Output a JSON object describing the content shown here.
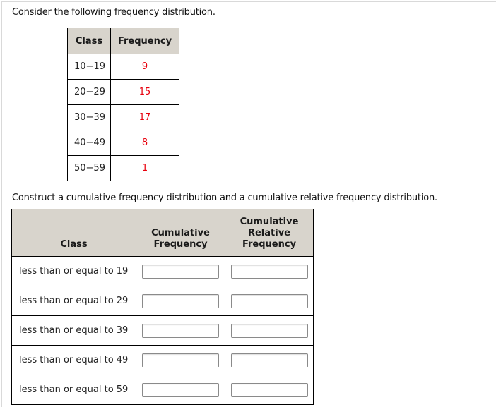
{
  "intro_text": "Consider the following frequency distribution.",
  "frequency_table": {
    "headers": [
      "Class",
      "Frequency"
    ],
    "rows": [
      {
        "class": "10−19",
        "frequency": "9"
      },
      {
        "class": "20−29",
        "frequency": "15"
      },
      {
        "class": "30−39",
        "frequency": "17"
      },
      {
        "class": "40−49",
        "frequency": "8"
      },
      {
        "class": "50−59",
        "frequency": "1"
      }
    ],
    "frequency_color": "#e8000d"
  },
  "instruction_text": "Construct a cumulative frequency distribution and a cumulative relative frequency distribution.",
  "answer_table": {
    "headers": {
      "class": "Class",
      "cumulative_frequency_line1": "Cumulative",
      "cumulative_frequency_line2": "Frequency",
      "cumulative_relative_line1": "Cumulative",
      "cumulative_relative_line2": "Relative",
      "cumulative_relative_line3": "Frequency"
    },
    "rows": [
      {
        "class": "less than or equal to 19",
        "cumulative_frequency": "",
        "cumulative_relative_frequency": ""
      },
      {
        "class": "less than or equal to 29",
        "cumulative_frequency": "",
        "cumulative_relative_frequency": ""
      },
      {
        "class": "less than or equal to 39",
        "cumulative_frequency": "",
        "cumulative_relative_frequency": ""
      },
      {
        "class": "less than or equal to 49",
        "cumulative_frequency": "",
        "cumulative_relative_frequency": ""
      },
      {
        "class": "less than or equal to 59",
        "cumulative_frequency": "",
        "cumulative_relative_frequency": ""
      }
    ]
  }
}
